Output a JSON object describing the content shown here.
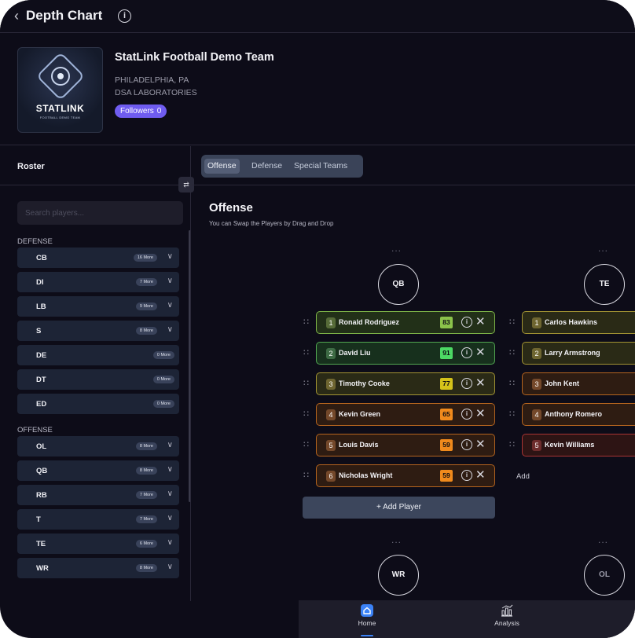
{
  "header": {
    "title": "Depth Chart",
    "back_icon": "chevron-left-icon",
    "info_icon": "info-icon"
  },
  "team": {
    "name": "StatLink Football Demo Team",
    "location": "PHILADELPHIA, PA",
    "organization": "DSA LABORATORIES",
    "followers_label": "Followers",
    "followers_count": "0",
    "logo_text": "STATLINK",
    "logo_subtext": "FOOTBALL DEMO TEAM"
  },
  "roster": {
    "title": "Roster",
    "search_placeholder": "Search players...",
    "groups": [
      {
        "label": "DEFENSE",
        "positions": [
          {
            "name": "CB",
            "more": "16 More",
            "chevron": true
          },
          {
            "name": "DI",
            "more": "7 More",
            "chevron": true
          },
          {
            "name": "LB",
            "more": "9 More",
            "chevron": true
          },
          {
            "name": "S",
            "more": "8 More",
            "chevron": true
          },
          {
            "name": "DE",
            "more": "0 More",
            "chevron": false
          },
          {
            "name": "DT",
            "more": "0 More",
            "chevron": false
          },
          {
            "name": "ED",
            "more": "0 More",
            "chevron": false
          }
        ]
      },
      {
        "label": "OFFENSE",
        "positions": [
          {
            "name": "OL",
            "more": "8 More",
            "chevron": true
          },
          {
            "name": "QB",
            "more": "8 More",
            "chevron": true
          },
          {
            "name": "RB",
            "more": "7 More",
            "chevron": true
          },
          {
            "name": "T",
            "more": "7 More",
            "chevron": true
          },
          {
            "name": "TE",
            "more": "6 More",
            "chevron": true
          },
          {
            "name": "WR",
            "more": "8 More",
            "chevron": true
          }
        ]
      }
    ]
  },
  "tabs": [
    {
      "label": "Offense",
      "active": true
    },
    {
      "label": "Defense",
      "active": false
    },
    {
      "label": "Special Teams",
      "active": false
    }
  ],
  "section": {
    "title": "Offense",
    "subtitle": "You can Swap the Players by Drag and Drop"
  },
  "depth": {
    "more_dots": "...",
    "columns": [
      {
        "position": "QB",
        "players": [
          {
            "rank": "1",
            "name": "Ronald Rodriguez",
            "rating": "83",
            "tier": "green"
          },
          {
            "rank": "2",
            "name": "David Liu",
            "rating": "91",
            "tier": "bright-green"
          },
          {
            "rank": "3",
            "name": "Timothy Cooke",
            "rating": "77",
            "tier": "olive"
          },
          {
            "rank": "4",
            "name": "Kevin Green",
            "rating": "65",
            "tier": "orange"
          },
          {
            "rank": "5",
            "name": "Louis Davis",
            "rating": "59",
            "tier": "orange"
          },
          {
            "rank": "6",
            "name": "Nicholas Wright",
            "rating": "59",
            "tier": "orange"
          }
        ],
        "add_player_label": "+ Add Player"
      },
      {
        "position": "TE",
        "players": [
          {
            "rank": "1",
            "name": "Carlos Hawkins",
            "tier": "olive"
          },
          {
            "rank": "2",
            "name": "Larry Armstrong",
            "tier": "olive"
          },
          {
            "rank": "3",
            "name": "John Kent",
            "tier": "orange"
          },
          {
            "rank": "4",
            "name": "Anthony Romero",
            "tier": "orange"
          },
          {
            "rank": "5",
            "name": "Kevin Williams",
            "tier": "red"
          }
        ],
        "add_label": "Add"
      }
    ],
    "next_row": [
      "WR",
      "OL"
    ]
  },
  "tier_colors": {
    "green": {
      "border": "#7fb648",
      "bg": "#223018",
      "num": "#566b38",
      "rating": "#8bc34a"
    },
    "bright-green": {
      "border": "#52a852",
      "bg": "#17301d",
      "num": "#3d6a44",
      "rating": "#4cd964"
    },
    "olive": {
      "border": "#a39433",
      "bg": "#2a2a16",
      "num": "#6e6530",
      "rating": "#d4c21a"
    },
    "orange": {
      "border": "#b5641e",
      "bg": "#2e1c12",
      "num": "#74482a",
      "rating": "#f08a1c"
    },
    "red": {
      "border": "#a83434",
      "bg": "#2d1414",
      "num": "#6d2c2c",
      "rating": "#e04848"
    }
  },
  "bottom_nav": [
    {
      "label": "Home",
      "icon": "home-icon",
      "active": true
    },
    {
      "label": "Analysis",
      "icon": "analysis-chart-icon",
      "active": false
    }
  ]
}
